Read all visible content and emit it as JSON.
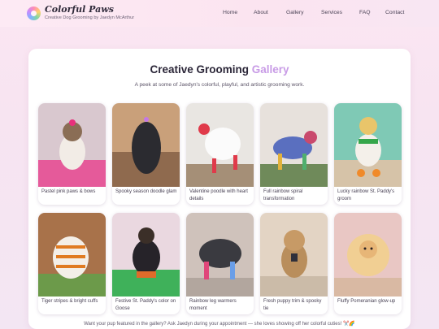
{
  "header": {
    "brand_name": "Colorful Paws",
    "brand_tagline": "Creative Dog Grooming by Jaedyn McArthur",
    "logo_icon": "paw-rainbow-icon",
    "nav": [
      {
        "label": "Home"
      },
      {
        "label": "About"
      },
      {
        "label": "Gallery"
      },
      {
        "label": "Services"
      },
      {
        "label": "FAQ"
      },
      {
        "label": "Contact"
      }
    ]
  },
  "gallery": {
    "title_main": "Creative Grooming",
    "title_accent": "Gallery",
    "subtitle": "A peek at some of Jaedyn's colorful, playful, and artistic grooming work.",
    "items": [
      {
        "caption": "Pastel pink paws & bows"
      },
      {
        "caption": "Spooky season doodle glam"
      },
      {
        "caption": "Valentine poodle with heart details"
      },
      {
        "caption": "Full rainbow spiral transformation"
      },
      {
        "caption": "Lucky rainbow St. Paddy's groom"
      },
      {
        "caption": "Tiger stripes & bright cuffs"
      },
      {
        "caption": "Festive St. Paddy's color on Goose"
      },
      {
        "caption": "Rainbow leg warmers moment"
      },
      {
        "caption": "Fresh puppy trim & spooky tie"
      },
      {
        "caption": "Fluffy Pomeranian glow-up"
      }
    ]
  },
  "footer": {
    "text": "Want your pup featured in the gallery? Ask Jaedyn during your appointment — she loves showing off her colorful cuties! ✂️🌈"
  },
  "colors": {
    "accent": "#c89be6",
    "background": "#fbe6f2"
  }
}
